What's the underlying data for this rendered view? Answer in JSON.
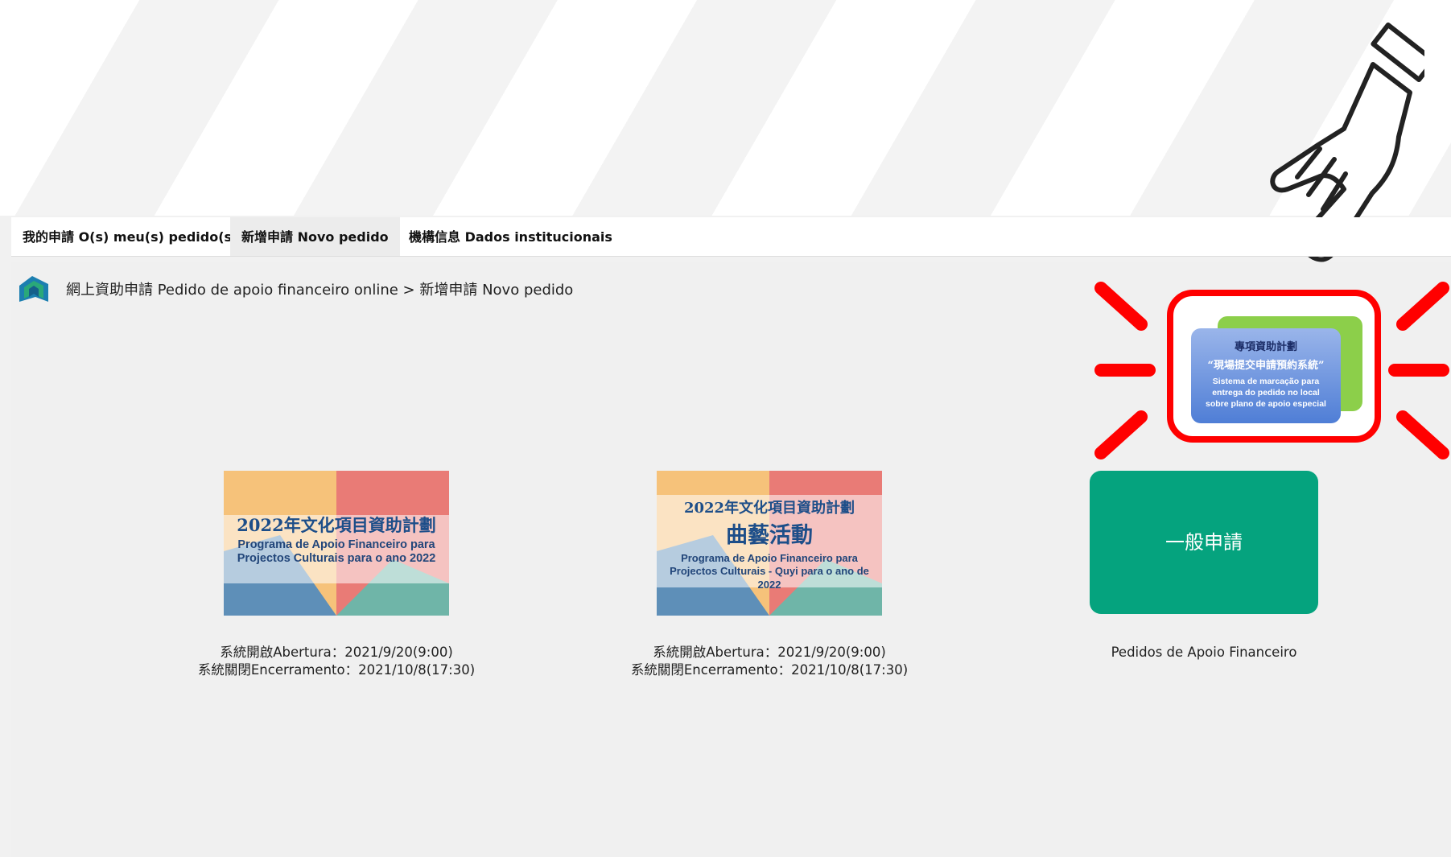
{
  "tabs": [
    {
      "label": "我的申請 O(s) meu(s) pedido(s)"
    },
    {
      "label": "新增申請 Novo pedido"
    },
    {
      "label": "機構信息 Dados institucionais"
    }
  ],
  "breadcrumb": {
    "root": "網上資助申請 Pedido de apoio financeiro online",
    "separator": " > ",
    "current": "新增申請 Novo pedido"
  },
  "cards": [
    {
      "title_cn": "2022年文化項目資助計劃",
      "subtitle_line1": "Programa de Apoio Financeiro para",
      "subtitle_line2": "Projectos Culturais para o ano 2022",
      "open_label": "系統開啟Abertura：2021/9/20(9:00)",
      "close_label": "系統關閉Encerramento：2021/10/8(17:30)"
    },
    {
      "title_cn": "2022年文化項目資助計劃",
      "title_cn2": "曲藝活動",
      "subtitle_line1": "Programa de Apoio Financeiro para",
      "subtitle_line2": "Projectos Culturais - Quyi para o ano de 2022",
      "open_label": "系統開啟Abertura：2021/9/20(9:00)",
      "close_label": "系統關閉Encerramento：2021/10/8(17:30)"
    }
  ],
  "general": {
    "button_label": "一般申請",
    "caption": "Pedidos de Apoio Financeiro"
  },
  "special": {
    "line1": "專項資助計劃",
    "line2": "“現場提交申請預約系統”",
    "line3a": "Sistema de marcação para",
    "line3b": "entrega do pedido no local",
    "line3c": "sobre plano de apoio especial"
  },
  "colors": {
    "general_button": "#05a37e",
    "highlight": "#ff0000"
  }
}
